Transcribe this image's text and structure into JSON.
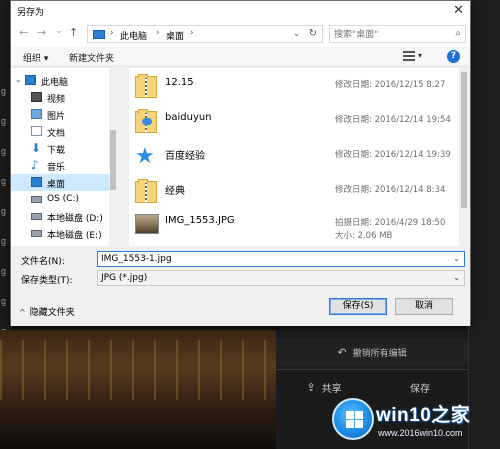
{
  "dialog": {
    "title": "另存为",
    "close_glyph": "✕",
    "nav": {
      "back": "←",
      "forward": "→",
      "history": "⌄",
      "up": "↑"
    },
    "breadcrumb": [
      "此电脑",
      "桌面"
    ],
    "breadcrumb_sep": "›",
    "breadcrumb_dropdown": "⌄",
    "refresh": "↻",
    "search_placeholder": "搜索\"桌面\"",
    "toolbar": {
      "organize": "组织 ▾",
      "new_folder": "新建文件夹",
      "view_dropdown": "▾",
      "help": "?"
    },
    "nav_pane": [
      {
        "label": "此电脑",
        "icon": "computer-icon"
      },
      {
        "label": "视频",
        "icon": "video-icon"
      },
      {
        "label": "图片",
        "icon": "pictures-icon"
      },
      {
        "label": "文档",
        "icon": "documents-icon"
      },
      {
        "label": "下载",
        "icon": "download-icon"
      },
      {
        "label": "音乐",
        "icon": "music-icon"
      },
      {
        "label": "桌面",
        "icon": "desktop-icon",
        "selected": true
      },
      {
        "label": "OS (C:)",
        "icon": "drive-icon"
      },
      {
        "label": "本地磁盘 (D:)",
        "icon": "drive-icon"
      },
      {
        "label": "本地磁盘 (E:)",
        "icon": "drive-icon"
      }
    ],
    "files": [
      {
        "name": "12.15",
        "icon": "folder-icon",
        "meta": "修改日期: 2016/12/15 8:27"
      },
      {
        "name": "baiduyun",
        "icon": "folder-cloud-icon",
        "meta": "修改日期: 2016/12/14 19:54"
      },
      {
        "name": "百度经验",
        "icon": "star-icon",
        "meta": "修改日期: 2016/12/14 19:39"
      },
      {
        "name": "经典",
        "icon": "folder-icon",
        "meta": "修改日期: 2016/12/14 8:34"
      },
      {
        "name": "IMG_1553.JPG",
        "icon": "image-thumbnail-icon",
        "meta": "拍摄日期: 2016/4/29 18:50",
        "meta2": "大小: 2.06 MB"
      }
    ],
    "filename_label": "文件名(N):",
    "filename_value": "IMG_1553-1.jpg",
    "filetype_label": "保存类型(T):",
    "filetype_value": "JPG (*.jpg)",
    "hide_folders": "隐藏文件夹",
    "save_button": "保存(S)",
    "cancel_button": "取消"
  },
  "background": {
    "left_glyphs": [
      "g",
      "g",
      "g",
      "g",
      "g",
      "g",
      "g",
      "g",
      "g",
      "g",
      "g",
      "g",
      "g"
    ],
    "undo_all_label": "撤销所有编辑",
    "share_label": "共享",
    "save_label": "保存"
  },
  "watermark": {
    "title": "win10之家",
    "url": "www.2016win10.com"
  },
  "colors": {
    "accent": "#2f7ad0",
    "selection": "#cde8ff",
    "dark_bg": "#141414"
  }
}
